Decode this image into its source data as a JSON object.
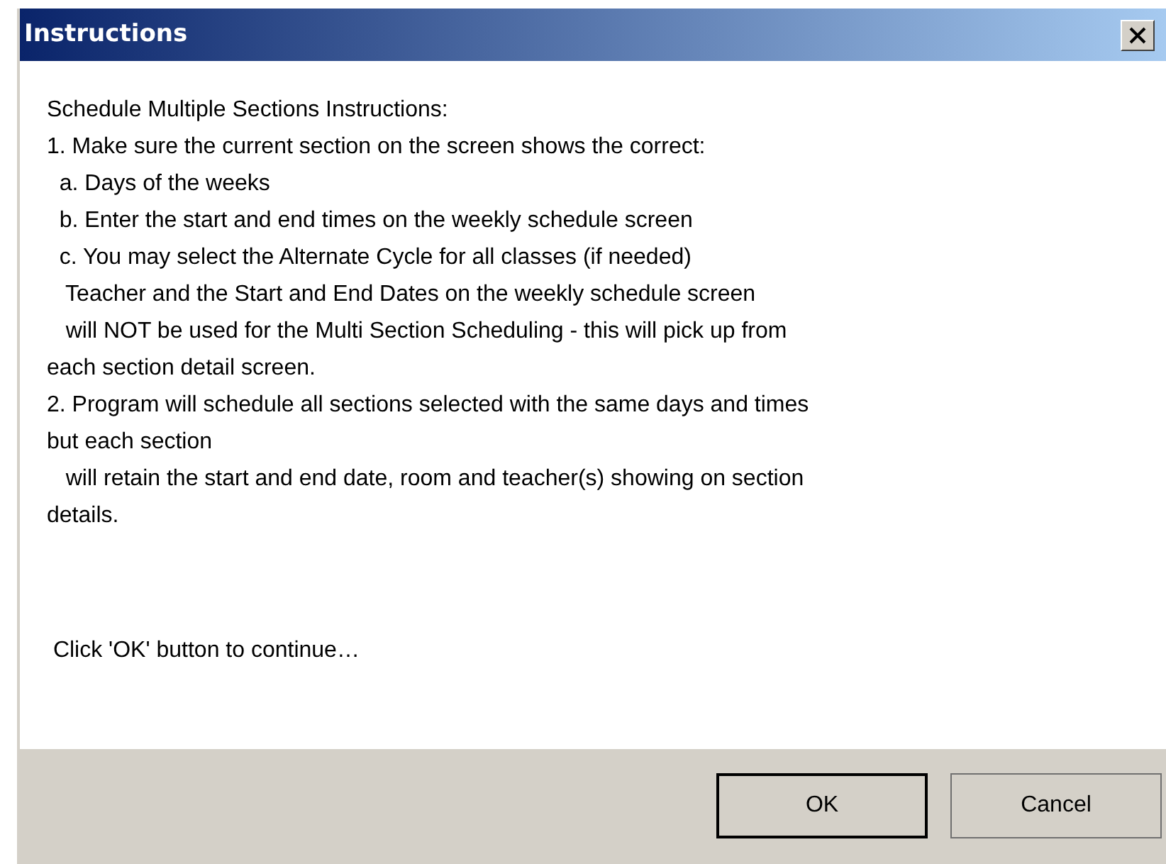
{
  "window": {
    "title": "Instructions"
  },
  "instructions": [
    "Schedule Multiple Sections Instructions:",
    "1. Make sure the current section on the screen shows the correct:",
    "  a. Days of the weeks",
    "  b. Enter the start and end times on the weekly schedule screen",
    "  c. You may select the Alternate Cycle for all classes (if needed)",
    "   Teacher and the Start and End Dates on the weekly schedule screen",
    "   will NOT be used for the Multi Section Scheduling - this will pick up from",
    "each section detail screen.",
    "2. Program will schedule all sections selected with the same days and times",
    "but each section",
    "   will retain the start and end date, room and teacher(s) showing on section",
    "details."
  ],
  "prompt": " Click 'OK' button to continue…",
  "buttons": [
    {
      "label": "OK",
      "default": true
    },
    {
      "label": "Cancel",
      "default": false
    }
  ]
}
